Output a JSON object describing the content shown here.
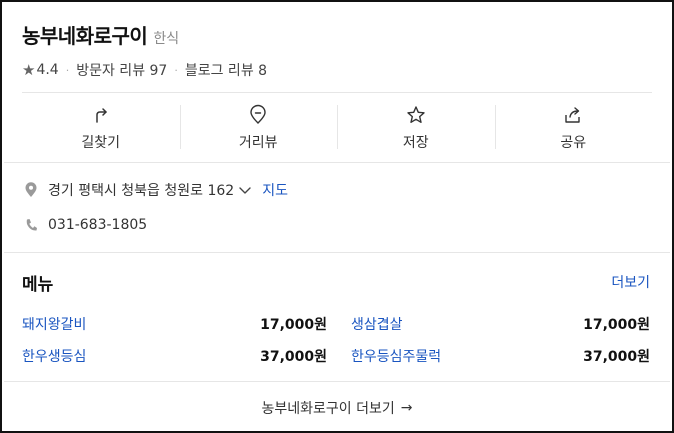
{
  "place": {
    "name": "농부네화로구이",
    "category": "한식",
    "rating": "4.4",
    "visitor_reviews": "방문자 리뷰 97",
    "blog_reviews": "블로그 리뷰 8"
  },
  "actions": [
    {
      "label": "길찾기",
      "icon": "directions-icon"
    },
    {
      "label": "거리뷰",
      "icon": "map-pin-icon"
    },
    {
      "label": "저장",
      "icon": "star-icon"
    },
    {
      "label": "공유",
      "icon": "share-icon"
    }
  ],
  "info": {
    "address": "경기 평택시 청북읍 청원로 162",
    "map_link": "지도",
    "phone": "031-683-1805"
  },
  "menu": {
    "title": "메뉴",
    "more": "더보기",
    "items": [
      {
        "name": "돼지왕갈비",
        "price": "17,000원"
      },
      {
        "name": "생삼겹살",
        "price": "17,000원"
      },
      {
        "name": "한우생등심",
        "price": "37,000원"
      },
      {
        "name": "한우등심주물럭",
        "price": "37,000원"
      }
    ]
  },
  "footer": {
    "label": "농부네화로구이 더보기",
    "arrow": "→"
  },
  "colors": {
    "link": "#1a55c0",
    "border": "#111111",
    "divider": "#e6e6e6"
  }
}
